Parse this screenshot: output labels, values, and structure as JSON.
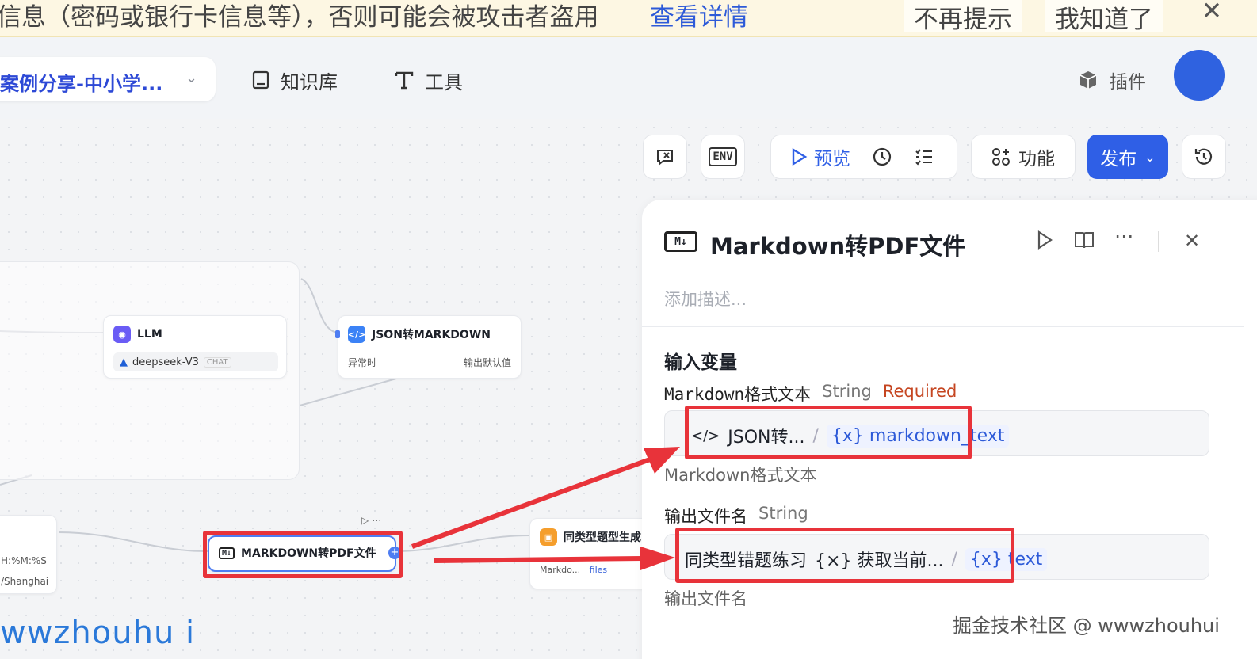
{
  "banner": {
    "text": "信息（密码或银行卡信息等），否则可能会被攻击者盗用",
    "link": "查看详情",
    "dismiss": "不再提示",
    "ack": "我知道了",
    "close": "✕"
  },
  "header": {
    "app_title": "案例分享-中小学...",
    "nav": [
      {
        "label": "知识库",
        "icon": "book-icon"
      },
      {
        "label": "工具",
        "icon": "tool-icon"
      }
    ],
    "plugin_label": "插件"
  },
  "toolbar": {
    "env": "ENV",
    "preview": "预览",
    "feature": "功能",
    "publish": "发布"
  },
  "nodes": {
    "llm": {
      "title": "LLM",
      "model": "deepseek-V3",
      "tag": "CHAT"
    },
    "json2md": {
      "title": "JSON转MARKDOWN",
      "left": "异常时",
      "right": "输出默认值"
    },
    "md2pdf": {
      "title": "MARKDOWN转PDF文件"
    },
    "similar": {
      "title": "同类型题型生成",
      "input1": "Markdo...",
      "input2": "files"
    },
    "partial": {
      "line1": "H:%M:%S",
      "line2": "/Shanghai"
    }
  },
  "panel": {
    "title": "Markdown转PDF文件",
    "icon_text": "M↓",
    "description_placeholder": "添加描述...",
    "section": "输入变量",
    "fields": [
      {
        "name": "Markdown格式文本",
        "type": "String",
        "required": "Required",
        "source_node": "JSON转...",
        "source_var": "markdown_text",
        "hint": "Markdown格式文本"
      },
      {
        "name": "输出文件名",
        "type": "String",
        "prefix": "同类型错题练习",
        "source_node": "获取当前...",
        "source_var": "text",
        "hint": "输出文件名"
      }
    ]
  },
  "watermarks": {
    "left": "wwzhouhu i",
    "right": "掘金技术社区 @ wwwzhouhui"
  },
  "colors": {
    "accent": "#2f5fe6",
    "highlight": "#e8333a"
  }
}
